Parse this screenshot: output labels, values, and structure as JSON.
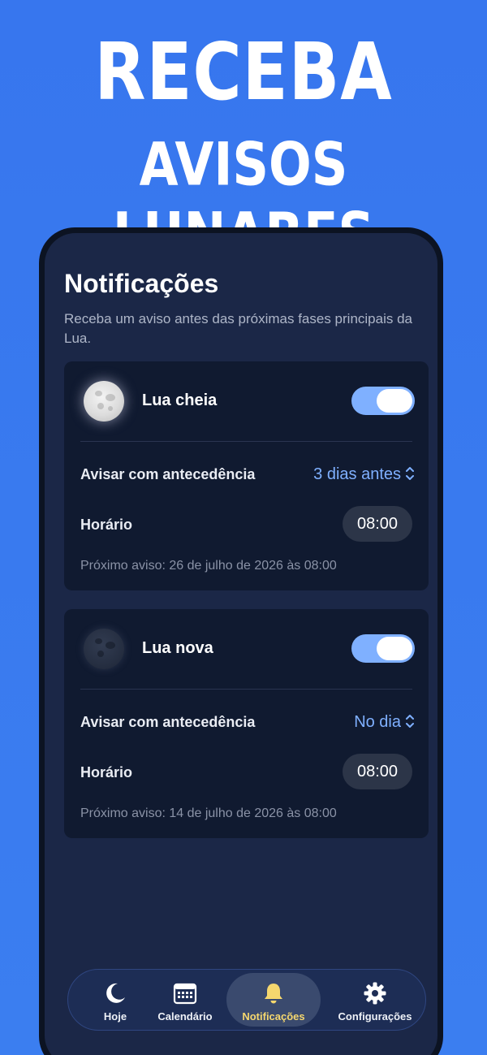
{
  "headline": {
    "line1": "RECEBA",
    "line2": "AVISOS LUNARES"
  },
  "screen": {
    "title": "Notificações",
    "subtitle": "Receba um aviso antes das próximas fases principais da Lua."
  },
  "cards": [
    {
      "name": "Lua cheia",
      "moon_icon": "full-moon-icon",
      "enabled": true,
      "advance_label": "Avisar com antecedência",
      "advance_value": "3 dias antes",
      "time_label": "Horário",
      "time_value": "08:00",
      "next_notice": "Próximo aviso: 26 de julho de 2026 às 08:00"
    },
    {
      "name": "Lua nova",
      "moon_icon": "new-moon-icon",
      "enabled": true,
      "advance_label": "Avisar com antecedência",
      "advance_value": "No dia",
      "time_label": "Horário",
      "time_value": "08:00",
      "next_notice": "Próximo aviso: 14 de julho de 2026 às 08:00"
    }
  ],
  "tabbar": {
    "items": [
      {
        "label": "Hoje",
        "icon": "moon-icon",
        "active": false
      },
      {
        "label": "Calendário",
        "icon": "calendar-icon",
        "active": false
      },
      {
        "label": "Notificações",
        "icon": "bell-icon",
        "active": true
      },
      {
        "label": "Configurações",
        "icon": "gear-icon",
        "active": false
      }
    ]
  },
  "colors": {
    "background": "#3776ee",
    "screen": "#1b2747",
    "card": "#101a30",
    "accent": "#7fb0ff",
    "active_tab_label": "#f5d76e"
  }
}
